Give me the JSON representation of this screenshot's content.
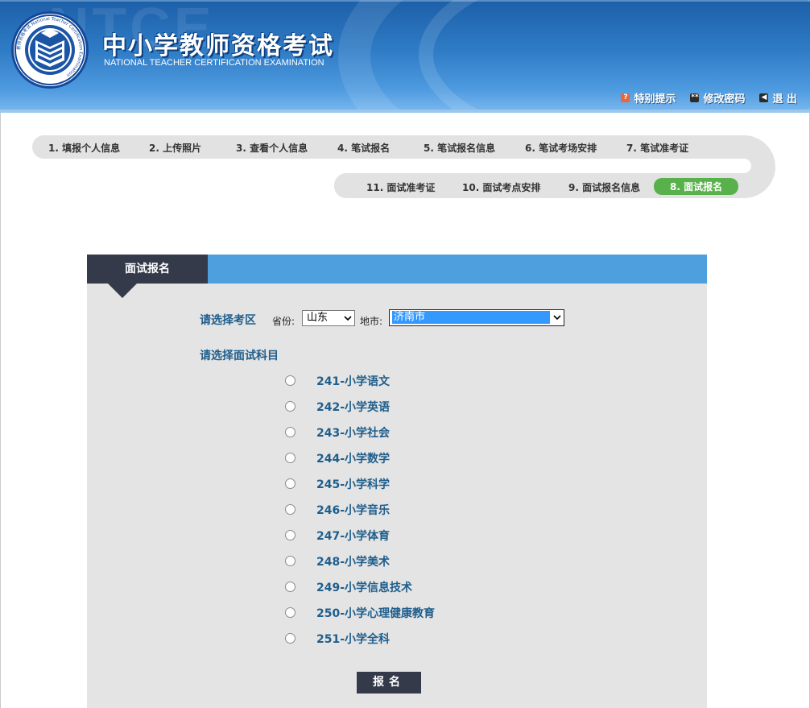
{
  "site": {
    "title": "中小学教师资格考试",
    "subtitle": "NATIONAL TEACHER CERTIFICATION EXAMINATION",
    "logo_ring_text": "教师资格考试 National Teacher Certification Examination"
  },
  "top_links": [
    {
      "label": "特别提示",
      "icon": "notice-icon",
      "color": "#e8663a"
    },
    {
      "label": "修改密码",
      "icon": "password-icon",
      "color": "#2b2b2b"
    },
    {
      "label": "退 出",
      "icon": "exit-icon",
      "color": "#2b2b2b"
    }
  ],
  "steps_row1": [
    "1. 填报个人信息",
    "2. 上传照片",
    "3. 查看个人信息",
    "4. 笔试报名",
    "5. 笔试报名信息",
    "6. 笔试考场安排",
    "7. 笔试准考证"
  ],
  "steps_row2": [
    "11. 面试准考证",
    "10. 面试考点安排",
    "9. 面试报名信息",
    "8. 面试报名"
  ],
  "active_step": "8. 面试报名",
  "panel": {
    "tab_label": "面试报名",
    "region_label": "请选择考区",
    "province_label": "省份:",
    "province_value": "山东",
    "city_label": "地市:",
    "city_value": "济南市",
    "subject_label": "请选择面试科目",
    "subjects": [
      "241-小学语文",
      "242-小学英语",
      "243-小学社会",
      "244-小学数学",
      "245-小学科学",
      "246-小学音乐",
      "247-小学体育",
      "248-小学美术",
      "249-小学信息技术",
      "250-小学心理健康教育",
      "251-小学全科"
    ],
    "submit_label": "报名"
  },
  "colors": {
    "header_blue": "#2f7cc6",
    "panel_bar": "#4e9fde",
    "dark_tab": "#343a49",
    "active_step": "#58b14a",
    "label_blue": "#1f5e8c"
  }
}
